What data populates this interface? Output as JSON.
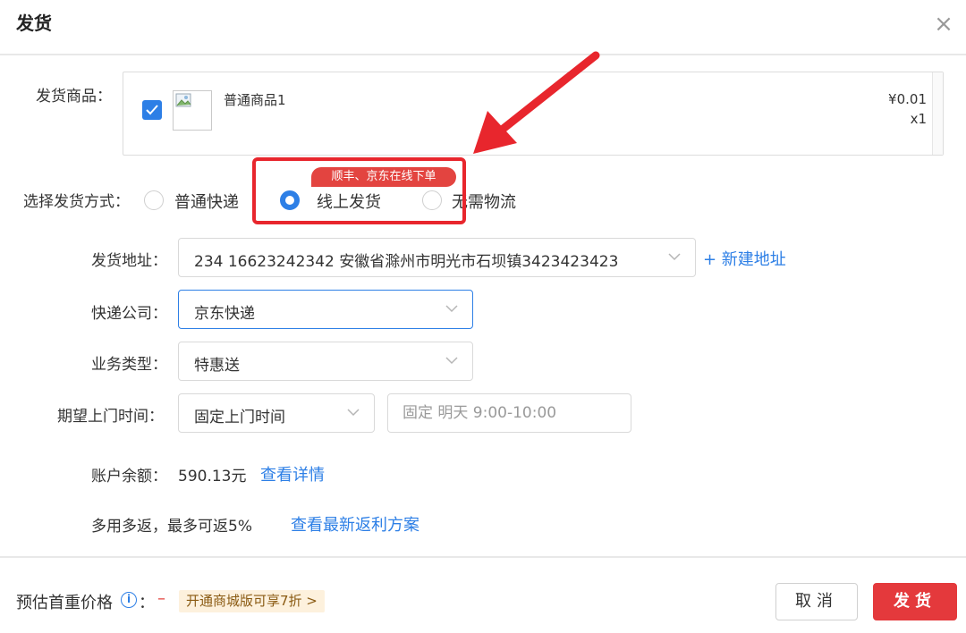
{
  "dialog": {
    "title": "发货",
    "close_glyph": "×"
  },
  "goods": {
    "label": "发货商品：",
    "items": [
      {
        "name": "普通商品1",
        "price": "¥0.01",
        "qty": "x1",
        "checked": true
      }
    ]
  },
  "shipping_method": {
    "label": "选择发货方式：",
    "options": [
      {
        "label": "普通快递",
        "selected": false
      },
      {
        "label": "线上发货",
        "selected": true
      },
      {
        "label": "无需物流",
        "selected": false
      }
    ],
    "callout_badge": "顺丰、京东在线下单"
  },
  "address": {
    "label": "发货地址：",
    "value": "234 16623242342 安徽省滁州市明光市石坝镇3423423423",
    "new_link": "+ 新建地址"
  },
  "courier": {
    "label": "快递公司：",
    "value": "京东快递"
  },
  "business_type": {
    "label": "业务类型：",
    "value": "特惠送"
  },
  "pickup_time": {
    "label": "期望上门时间：",
    "mode_value": "固定上门时间",
    "time_placeholder": "固定 明天 9:00-10:00"
  },
  "balance": {
    "label": "账户余额：",
    "value": "590.13元",
    "link": "查看详情"
  },
  "rebate": {
    "text": "多用多返，最多可返5%",
    "link": "查看最新返利方案"
  },
  "footer": {
    "estimate_label": "预估首重价格",
    "info_glyph": "i",
    "colon": "：",
    "estimate_value": "–",
    "promo": "开通商城版可享7折 >",
    "cancel": "取消",
    "confirm": "发货"
  },
  "colors": {
    "accent": "#2d7fe6",
    "danger": "#e4393c",
    "annotation": "#e8262d",
    "promo_bg": "#fdf1dd"
  },
  "icons": {
    "close": "close-icon",
    "check": "check-icon",
    "image": "broken-image-icon",
    "chevron": "chevron-down-icon",
    "info": "info-icon",
    "arrow": "annotation-arrow-icon"
  }
}
